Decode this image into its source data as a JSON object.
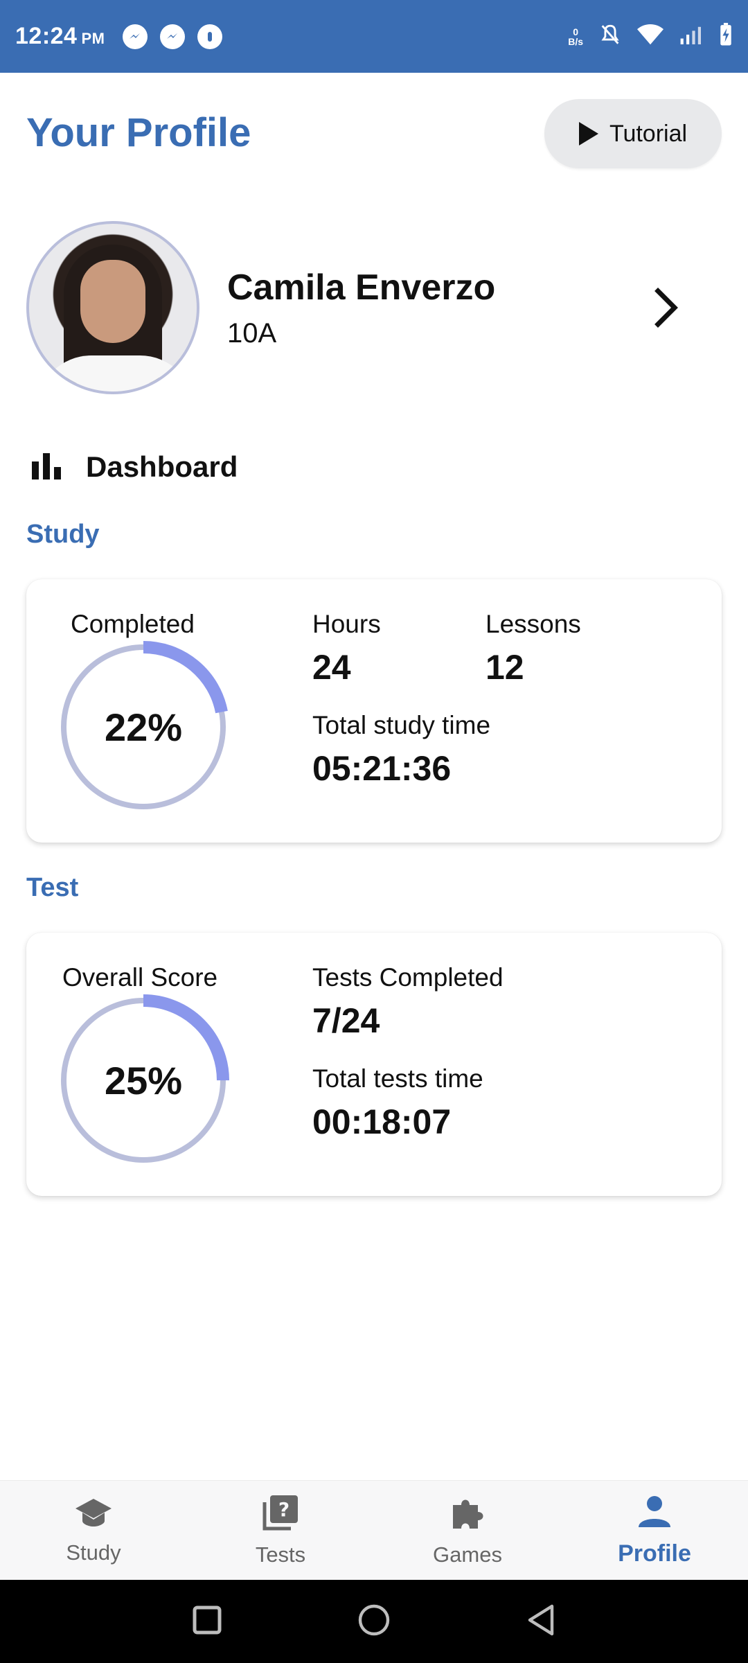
{
  "status_bar": {
    "time": "12:24",
    "ampm": "PM",
    "net_speed_value": "0",
    "net_speed_unit": "B/s"
  },
  "header": {
    "title": "Your Profile",
    "tutorial_label": "Tutorial"
  },
  "profile": {
    "name": "Camila Enverzo",
    "class": "10A"
  },
  "dashboard": {
    "label": "Dashboard"
  },
  "study": {
    "section_label": "Study",
    "ring_label": "Completed",
    "ring_value": "22%",
    "ring_fraction": 0.22,
    "hours_label": "Hours",
    "hours_value": "24",
    "lessons_label": "Lessons",
    "lessons_value": "12",
    "total_label": "Total study time",
    "total_value": "05:21:36"
  },
  "test": {
    "section_label": "Test",
    "ring_label": "Overall Score",
    "ring_value": "25%",
    "ring_fraction": 0.25,
    "completed_label": "Tests Completed",
    "completed_value": "7/24",
    "total_label": "Total tests time",
    "total_value": "00:18:07"
  },
  "bottom_nav": {
    "items": [
      {
        "label": "Study",
        "icon": "graduation-cap-icon"
      },
      {
        "label": "Tests",
        "icon": "quiz-icon"
      },
      {
        "label": "Games",
        "icon": "puzzle-icon"
      },
      {
        "label": "Profile",
        "icon": "person-icon"
      }
    ],
    "active": "Profile"
  },
  "colors": {
    "brand": "#3a6db3",
    "ring_track": "#b9bedb",
    "ring_progress": "#8a97ec"
  }
}
